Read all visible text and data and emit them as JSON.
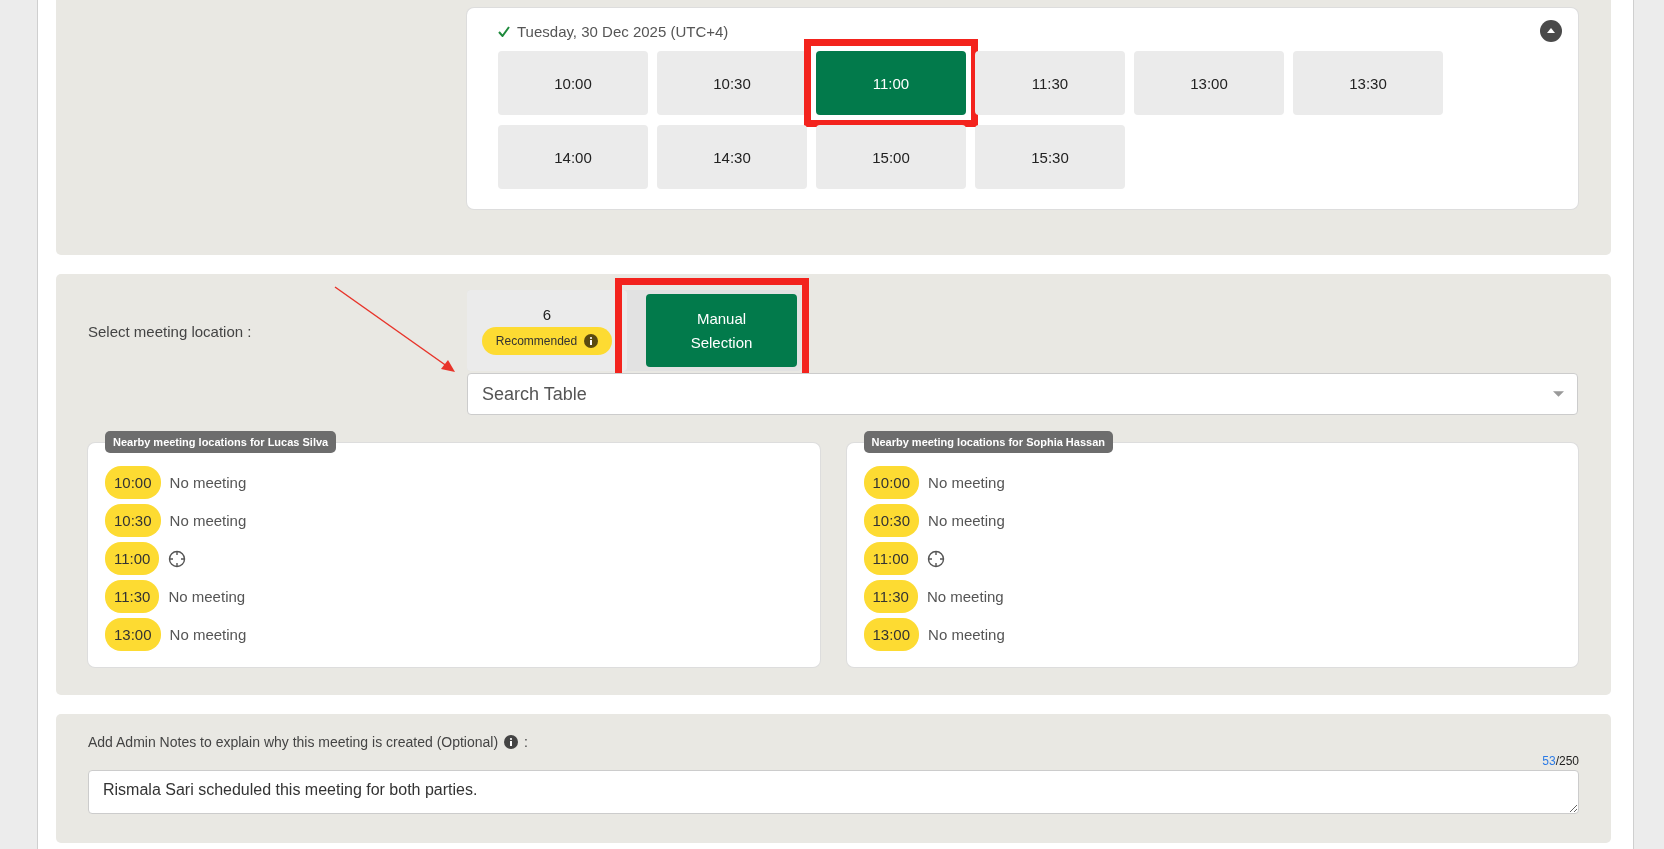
{
  "date_picker": {
    "date_label": "Tuesday, 30 Dec 2025 (UTC+4)",
    "confirmed": true,
    "expanded": true,
    "slots": [
      {
        "time": "10:00",
        "selected": false,
        "highlighted": false
      },
      {
        "time": "10:30",
        "selected": false,
        "highlighted": false
      },
      {
        "time": "11:00",
        "selected": true,
        "highlighted": true
      },
      {
        "time": "11:30",
        "selected": false,
        "highlighted": false
      },
      {
        "time": "13:00",
        "selected": false,
        "highlighted": false
      },
      {
        "time": "13:30",
        "selected": false,
        "highlighted": false
      },
      {
        "time": "14:00",
        "selected": false,
        "highlighted": false
      },
      {
        "time": "14:30",
        "selected": false,
        "highlighted": false
      },
      {
        "time": "15:00",
        "selected": false,
        "highlighted": false
      },
      {
        "time": "15:30",
        "selected": false,
        "highlighted": false
      }
    ]
  },
  "location": {
    "label": "Select meeting location :",
    "annotation_arrow": true,
    "modes": [
      {
        "kind": "recommended",
        "count": "6",
        "label": "Recommended",
        "selected": false,
        "highlighted": false
      },
      {
        "kind": "manual",
        "label": "Manual Selection",
        "selected": true,
        "highlighted": true
      }
    ],
    "search": {
      "placeholder": "Search Table"
    },
    "nearby": [
      {
        "title": "Nearby meeting locations for Lucas Silva",
        "rows": [
          {
            "time": "10:00",
            "kind": "text",
            "text": "No meeting"
          },
          {
            "time": "10:30",
            "kind": "text",
            "text": "No meeting"
          },
          {
            "time": "11:00",
            "kind": "target"
          },
          {
            "time": "11:30",
            "kind": "text",
            "text": "No meeting"
          },
          {
            "time": "13:00",
            "kind": "text",
            "text": "No meeting"
          }
        ]
      },
      {
        "title": "Nearby meeting locations for Sophia Hassan",
        "rows": [
          {
            "time": "10:00",
            "kind": "text",
            "text": "No meeting"
          },
          {
            "time": "10:30",
            "kind": "text",
            "text": "No meeting"
          },
          {
            "time": "11:00",
            "kind": "target"
          },
          {
            "time": "11:30",
            "kind": "text",
            "text": "No meeting"
          },
          {
            "time": "13:00",
            "kind": "text",
            "text": "No meeting"
          }
        ]
      }
    ]
  },
  "notes": {
    "label": "Add Admin Notes to explain why this meeting is created (Optional)",
    "label_suffix": ":",
    "count": "53",
    "max": "/250",
    "value": "Rismala Sari scheduled this meeting for both parties."
  }
}
